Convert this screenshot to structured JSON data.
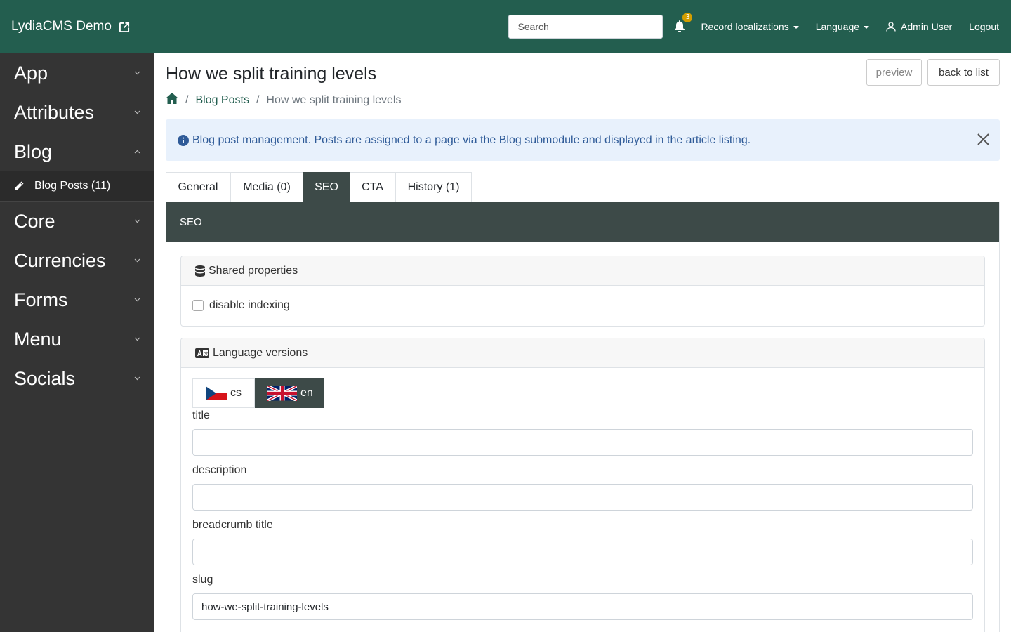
{
  "topbar": {
    "brand": "LydiaCMS Demo",
    "search_placeholder": "Search",
    "notification_count": "3",
    "record_localizations": "Record localizations",
    "language": "Language",
    "user": "Admin User",
    "logout": "Logout"
  },
  "sidebar": {
    "sections": [
      "App",
      "Attributes",
      "Blog",
      "Core",
      "Currencies",
      "Forms",
      "Menu",
      "Socials"
    ],
    "blog_sub": "Blog Posts (11)"
  },
  "page": {
    "title": "How we split training levels",
    "preview": "preview",
    "back": "back to list",
    "breadcrumb": {
      "sep": "/",
      "link": "Blog Posts",
      "current": "How we split training levels"
    },
    "alert": "Blog post management. Posts are assigned to a page via the Blog submodule and displayed in the article listing."
  },
  "tabs": [
    "General",
    "Media (0)",
    "SEO",
    "CTA",
    "History (1)"
  ],
  "panel": {
    "title": "SEO",
    "shared": {
      "title": "Shared properties",
      "checkbox": "disable indexing"
    },
    "lang": {
      "title": "Language versions",
      "tabs": [
        "cs",
        "en"
      ],
      "fields": {
        "title_label": "title",
        "title_value": "",
        "description_label": "description",
        "description_value": "",
        "breadcrumb_label": "breadcrumb title",
        "breadcrumb_value": "",
        "slug_label": "slug",
        "slug_value": "how-we-split-training-levels"
      }
    }
  },
  "colors": {
    "topbar": "#235e4f",
    "sidebar": "#343434",
    "panel_header": "#3d4a48",
    "alert_bg": "#e8f1fc",
    "badge": "#d39e00"
  },
  "icons": [
    "external-link-icon",
    "bell-icon",
    "user-icon",
    "chevron-down-icon",
    "chevron-up-icon",
    "pencil-icon",
    "home-icon",
    "info-circle-icon",
    "close-icon",
    "database-icon",
    "language-icon",
    "czech-flag-icon",
    "uk-flag-icon"
  ]
}
